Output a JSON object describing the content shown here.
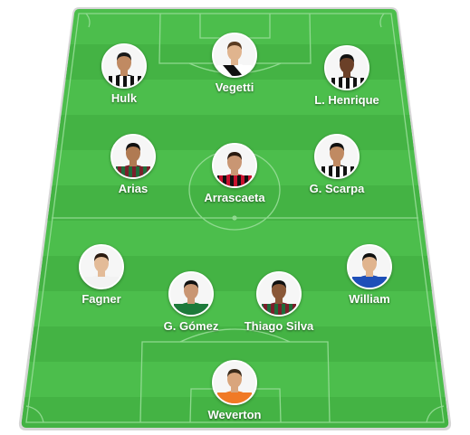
{
  "pitch": {
    "grass_light": "#4cbe4c",
    "grass_dark": "#44b344",
    "line_color": "#8fd98f",
    "frame_color": "#d9d9d9"
  },
  "players": [
    {
      "id": "hulk",
      "name": "Hulk",
      "kit": "stripes-bw"
    },
    {
      "id": "vegetti",
      "name": "Vegetti",
      "kit": "white-sash"
    },
    {
      "id": "l-henrique",
      "name": "L. Henrique",
      "kit": "stripes-bw"
    },
    {
      "id": "arias",
      "name": "Arias",
      "kit": "stripes-tricolor"
    },
    {
      "id": "arrascaeta",
      "name": "Arrascaeta",
      "kit": "stripes-rb"
    },
    {
      "id": "g-scarpa",
      "name": "G. Scarpa",
      "kit": "stripes-bw"
    },
    {
      "id": "fagner",
      "name": "Fagner",
      "kit": "white"
    },
    {
      "id": "g-gomez",
      "name": "G. Gómez",
      "kit": "green"
    },
    {
      "id": "thiago-silva",
      "name": "Thiago Silva",
      "kit": "stripes-tricolor"
    },
    {
      "id": "william",
      "name": "William",
      "kit": "blue"
    },
    {
      "id": "weverton",
      "name": "Weverton",
      "kit": "orange"
    }
  ]
}
